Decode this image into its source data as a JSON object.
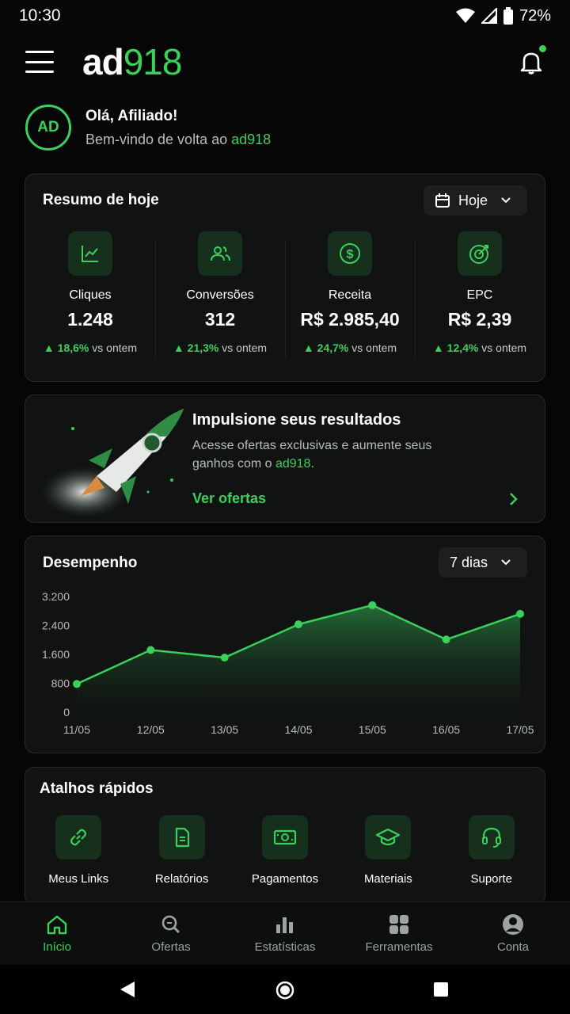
{
  "status": {
    "time": "10:30",
    "battery": "72%"
  },
  "app": {
    "logo_ad": "ad",
    "logo_num": "918"
  },
  "greeting": {
    "avatar": "AD",
    "title": "Olá, Afiliado!",
    "subtitle_prefix": "Bem-vindo de volta ao ",
    "subtitle_brand": "ad918"
  },
  "summary": {
    "title": "Resumo de hoje",
    "period": "Hoje",
    "stats": [
      {
        "label": "Cliques",
        "value": "1.248",
        "delta": "18,6%",
        "delta_suffix": "vs ontem",
        "icon": "chart-line-icon"
      },
      {
        "label": "Conversões",
        "value": "312",
        "delta": "21,3%",
        "delta_suffix": "vs ontem",
        "icon": "users-icon"
      },
      {
        "label": "Receita",
        "value": "R$ 2.985,40",
        "delta": "24,7%",
        "delta_suffix": "vs ontem",
        "icon": "dollar-icon"
      },
      {
        "label": "EPC",
        "value": "R$ 2,39",
        "delta": "12,4%",
        "delta_suffix": "vs ontem",
        "icon": "target-icon"
      }
    ]
  },
  "promo": {
    "title": "Impulsione seus resultados",
    "desc_prefix": "Acesse ofertas exclusivas e aumente seus ganhos com o ",
    "desc_brand": "ad918",
    "desc_suffix": ".",
    "link": "Ver ofertas"
  },
  "performance": {
    "title": "Desempenho",
    "period": "7 dias"
  },
  "chart_data": {
    "type": "area",
    "title": "Desempenho",
    "x": [
      "11/05",
      "12/05",
      "13/05",
      "14/05",
      "15/05",
      "16/05",
      "17/05"
    ],
    "values": [
      780,
      1720,
      1510,
      2430,
      2960,
      2010,
      2720
    ],
    "yticks": [
      "3.200",
      "2.400",
      "1.600",
      "800",
      "0"
    ],
    "ylim": [
      0,
      3200
    ],
    "grid": false,
    "color": "#3bcf5c"
  },
  "shortcuts": {
    "title": "Atalhos rápidos",
    "items": [
      {
        "label": "Meus Links",
        "icon": "link-icon"
      },
      {
        "label": "Relatórios",
        "icon": "document-icon"
      },
      {
        "label": "Pagamentos",
        "icon": "money-icon"
      },
      {
        "label": "Materiais",
        "icon": "graduation-cap-icon"
      },
      {
        "label": "Suporte",
        "icon": "headset-icon"
      }
    ]
  },
  "nav": {
    "items": [
      {
        "label": "Início",
        "icon": "home-icon"
      },
      {
        "label": "Ofertas",
        "icon": "search-icon"
      },
      {
        "label": "Estatísticas",
        "icon": "bar-chart-icon"
      },
      {
        "label": "Ferramentas",
        "icon": "grid-icon"
      },
      {
        "label": "Conta",
        "icon": "account-icon"
      }
    ]
  },
  "colors": {
    "accent": "#3bcf5c",
    "background": "#050605",
    "card": "#111312"
  }
}
